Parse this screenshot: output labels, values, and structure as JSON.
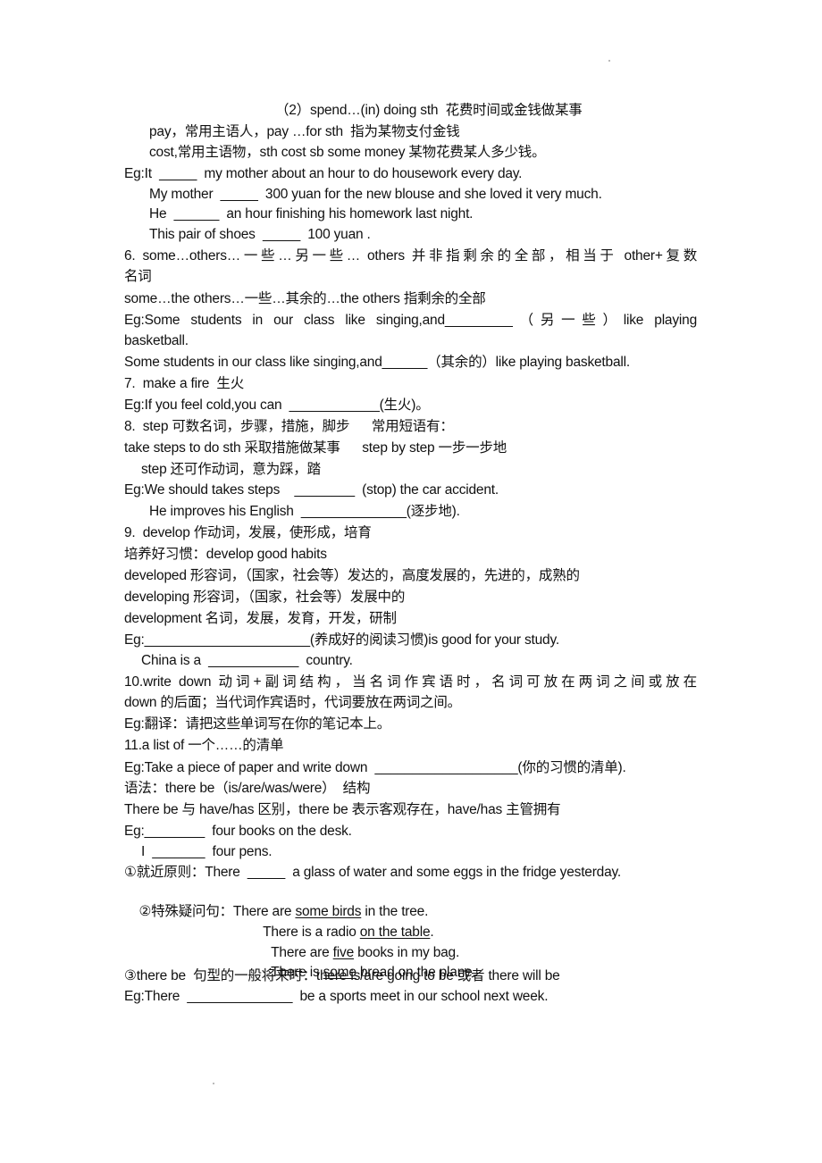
{
  "document": {
    "lines": [
      {
        "id": "spend-heading",
        "text": "（2）spend…(in) doing sth  花费时间或金钱做某事"
      },
      {
        "id": "pay-note",
        "text": "pay，常用主语人，pay …for sth  指为某物支付金钱"
      },
      {
        "id": "cost-note",
        "text": "cost,常用主语物，sth cost sb some money 某物花费某人多少钱。"
      },
      {
        "id": "eg-it",
        "text": "Eg:It  _____  my mother about an hour to do housework every day."
      },
      {
        "id": "eg-my-mother",
        "text": "My mother  _____  300 yuan for the new blouse and she loved it very much."
      },
      {
        "id": "eg-he",
        "text": "He  ______  an hour finishing his homework last night."
      },
      {
        "id": "eg-shoes",
        "text": "This pair of shoes  _____  100 yuan ."
      },
      {
        "id": "item6-line1",
        "text": "6.  some…others…一些…另一些…    others 并非指剩余的全部，相当于 other+复数"
      },
      {
        "id": "item6-line2",
        "text": "名词"
      },
      {
        "id": "item6-the-others",
        "text": "some…the others…一些…其余的…the others 指剩余的全部"
      },
      {
        "id": "eg-some-students-1a",
        "text": "Eg:Some students in our class like singing,and_________（另一些）like playing"
      },
      {
        "id": "eg-some-students-1b",
        "text": "basketball."
      },
      {
        "id": "eg-some-students-2",
        "text": "Some students in our class like singing,and______（其余的）like playing basketball."
      },
      {
        "id": "item7",
        "text": "7.  make a fire  生火"
      },
      {
        "id": "eg-fire",
        "text": "Eg:If you feel cold,you can  ____________(生火)。"
      },
      {
        "id": "item8",
        "text": "8.  step 可数名词，步骤，措施，脚步      常用短语有："
      },
      {
        "id": "item8-phrases",
        "text": "take steps to do sth 采取措施做某事      step by step 一步一步地"
      },
      {
        "id": "item8-verb",
        "text": "step 还可作动词，意为踩，踏"
      },
      {
        "id": "eg-steps",
        "text": "Eg:We should takes steps    ________  (stop) the car accident."
      },
      {
        "id": "eg-english",
        "text": "He improves his English  ______________(逐步地)."
      },
      {
        "id": "item9",
        "text": "9.  develop 作动词，发展，使形成，培育"
      },
      {
        "id": "item9-habits",
        "text": "培养好习惯：develop good habits"
      },
      {
        "id": "item9-developed",
        "text": "developed 形容词，（国家，社会等）发达的，高度发展的，先进的，成熟的"
      },
      {
        "id": "item9-developing",
        "text": "developing 形容词，（国家，社会等）发展中的"
      },
      {
        "id": "item9-development",
        "text": "development 名词，发展，发育，开发，研制"
      },
      {
        "id": "eg-reading",
        "text": "Eg:______________________(养成好的阅读习惯)is good for your study."
      },
      {
        "id": "eg-china",
        "text": "China is a  ____________  country."
      },
      {
        "id": "item10-line1",
        "text": "10.write down 动词+副词结构，当名词作宾语时，名词可放在两词之间或放在"
      },
      {
        "id": "item10-line2",
        "text": "down 的后面；当代词作宾语时，代词要放在两词之间。"
      },
      {
        "id": "eg-translate",
        "text": "Eg:翻译：请把这些单词写在你的笔记本上。"
      },
      {
        "id": "item11",
        "text": "11.a list of 一个……的清单"
      },
      {
        "id": "eg-list",
        "text": "Eg:Take a piece of paper and write down  ___________________(你的习惯的清单)."
      },
      {
        "id": "grammar-heading",
        "text": "语法：there be（is/are/was/were）  结构"
      },
      {
        "id": "grammar-diff",
        "text": "There be 与 have/has 区别，there be 表示客观存在，have/has 主管拥有"
      },
      {
        "id": "eg-books",
        "text": "Eg:________  four books on the desk."
      },
      {
        "id": "eg-pens",
        "text": "I  _______  four pens."
      },
      {
        "id": "rule1",
        "text": "①就近原则：There  _____  a glass of water and some eggs in the fridge yesterday."
      },
      {
        "id": "rule2-a",
        "parts": [
          {
            "t": "②特殊疑问句：There are "
          },
          {
            "t": "some birds",
            "u": true
          },
          {
            "t": " in the tree."
          }
        ]
      },
      {
        "id": "rule2-b",
        "parts": [
          {
            "t": "There is a radio "
          },
          {
            "t": "on the table",
            "u": true
          },
          {
            "t": "."
          }
        ]
      },
      {
        "id": "rule2-c",
        "parts": [
          {
            "t": "There are "
          },
          {
            "t": "five",
            "u": true
          },
          {
            "t": " books in my bag."
          }
        ]
      },
      {
        "id": "rule2-d",
        "parts": [
          {
            "t": "There is "
          },
          {
            "t": "some",
            "u": true
          },
          {
            "t": " bread on the plane."
          }
        ]
      },
      {
        "id": "rule3",
        "text": "③there be  句型的一般将来时：there is/are going to be 或者 there will be"
      },
      {
        "id": "eg-sports",
        "text": "Eg:There  ______________  be a sports meet in our school next week."
      }
    ]
  }
}
